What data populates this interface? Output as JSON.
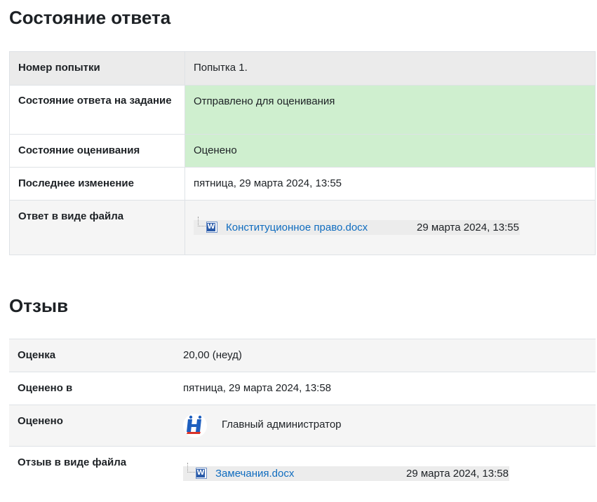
{
  "submission_status": {
    "heading": "Состояние ответа",
    "rows": [
      {
        "label": "Номер попытки",
        "value": "Попытка 1."
      },
      {
        "label": "Состояние ответа на задание",
        "value": "Отправлено для оценивания"
      },
      {
        "label": "Состояние оценивания",
        "value": "Оценено"
      },
      {
        "label": "Последнее изменение",
        "value": "пятница, 29 марта 2024, 13:55"
      },
      {
        "label": "Ответ в виде файла",
        "file_name": "Конституционное право.docx",
        "file_date": "29 марта 2024, 13:55",
        "file_icon": "word-document-icon"
      }
    ],
    "status_color": "#cfefcf"
  },
  "feedback": {
    "heading": "Отзыв",
    "rows": [
      {
        "label": "Оценка",
        "value": "20,00 (неуд)"
      },
      {
        "label": "Оценено в",
        "value": "пятница, 29 марта 2024, 13:58"
      },
      {
        "label": "Оценено",
        "value": "Главный администратор",
        "icon": "user-avatar-icon"
      },
      {
        "label": "Отзыв в виде файла",
        "file_name": "Замечания.docx",
        "file_date": "29 марта 2024, 13:58",
        "file_icon": "word-document-icon"
      }
    ]
  },
  "colors": {
    "link": "#0f6cbf",
    "header_row_bg": "#ebebeb",
    "stripe_bg": "#f5f5f5",
    "border": "#dee2e6"
  }
}
